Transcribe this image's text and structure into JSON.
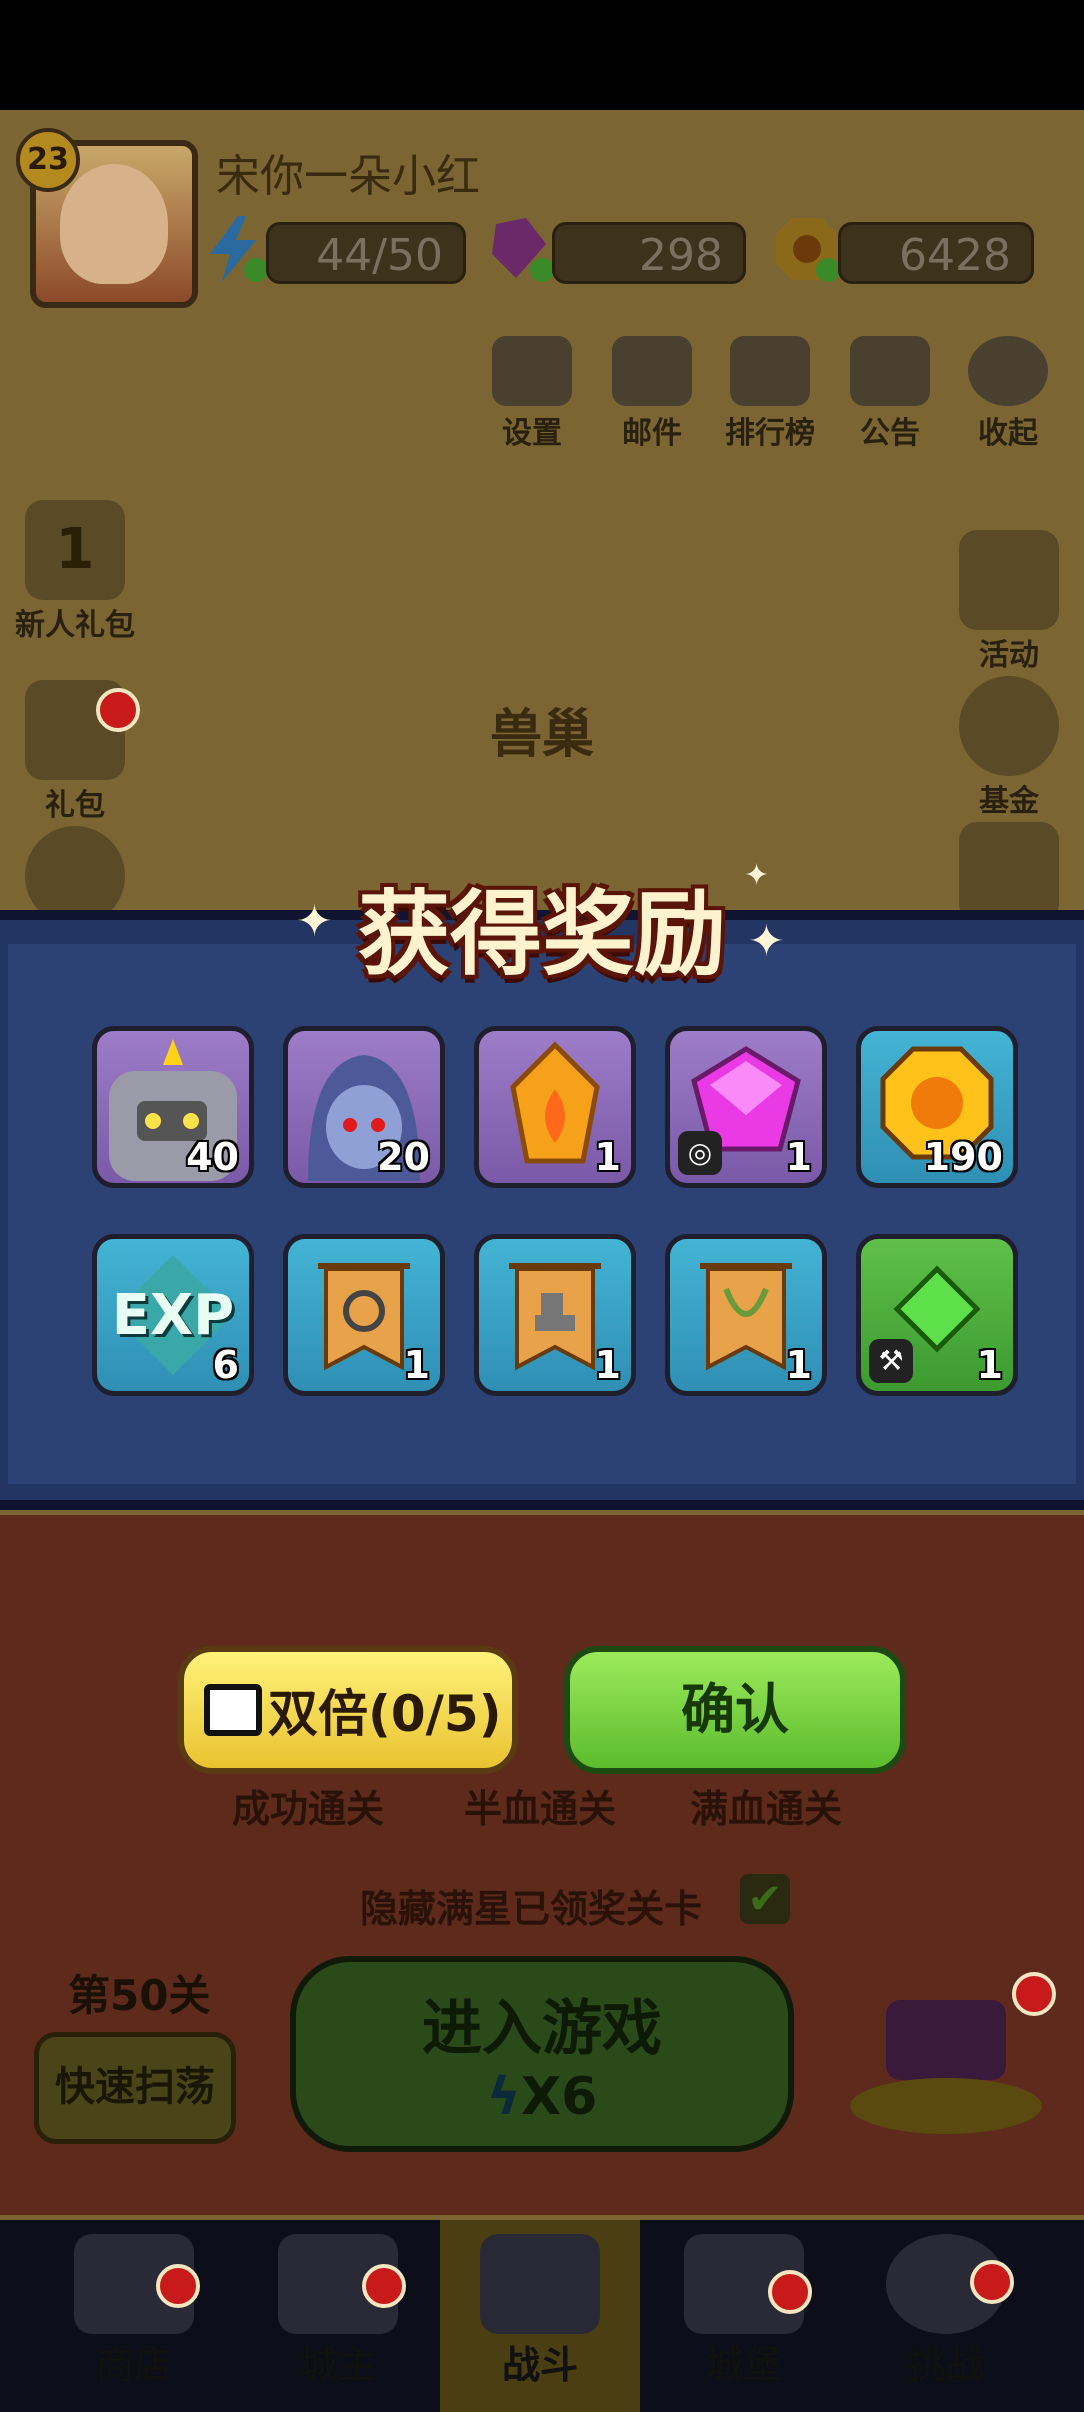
{
  "header": {
    "level": "23",
    "player_name": "宋你一朵小红",
    "energy": "44/50",
    "gems": "298",
    "coins": "6428"
  },
  "top_menu": [
    "设置",
    "邮件",
    "排行榜",
    "公告",
    "收起"
  ],
  "left_side": {
    "newbie_badge": "1",
    "newbie_label": "新人礼包",
    "gift_label": "礼包"
  },
  "right_side": [
    "活动",
    "基金"
  ],
  "stage_name": "兽巢",
  "reward_modal": {
    "title": "获得奖励",
    "items": [
      {
        "name": "robot-hero-shard",
        "qty": "40",
        "frame": "purple"
      },
      {
        "name": "dark-elf-hero-shard",
        "qty": "20",
        "frame": "purple"
      },
      {
        "name": "fire-crystal",
        "qty": "1",
        "frame": "purple"
      },
      {
        "name": "purple-gem-ring",
        "qty": "1",
        "frame": "purple"
      },
      {
        "name": "gold-coin",
        "qty": "190",
        "frame": "blue"
      },
      {
        "name": "exp",
        "qty": "6",
        "frame": "blue",
        "text": "EXP"
      },
      {
        "name": "ring-blueprint",
        "qty": "1",
        "frame": "blue"
      },
      {
        "name": "boots-blueprint",
        "qty": "1",
        "frame": "blue"
      },
      {
        "name": "necklace-blueprint",
        "qty": "1",
        "frame": "blue"
      },
      {
        "name": "green-gem-weapon",
        "qty": "1",
        "frame": "green"
      }
    ],
    "double_button": "双倍(0/5)",
    "confirm_button": "确认"
  },
  "stars": [
    "成功通关",
    "半血通关",
    "满血通关"
  ],
  "hide_checkbox_label": "隐藏满星已领奖关卡",
  "stage_number": "第50关",
  "sweep_button": "快速扫荡",
  "enter_button": {
    "line1": "进入游戏",
    "cost": "X6"
  },
  "bottom_nav": [
    "商店",
    "城主",
    "战斗",
    "城堡",
    "挑战"
  ],
  "colors": {
    "modal_bg": "#2d4274",
    "confirm_green": "#5cbc2c",
    "double_yellow": "#e9c330",
    "red_dot": "#c81a1a"
  }
}
